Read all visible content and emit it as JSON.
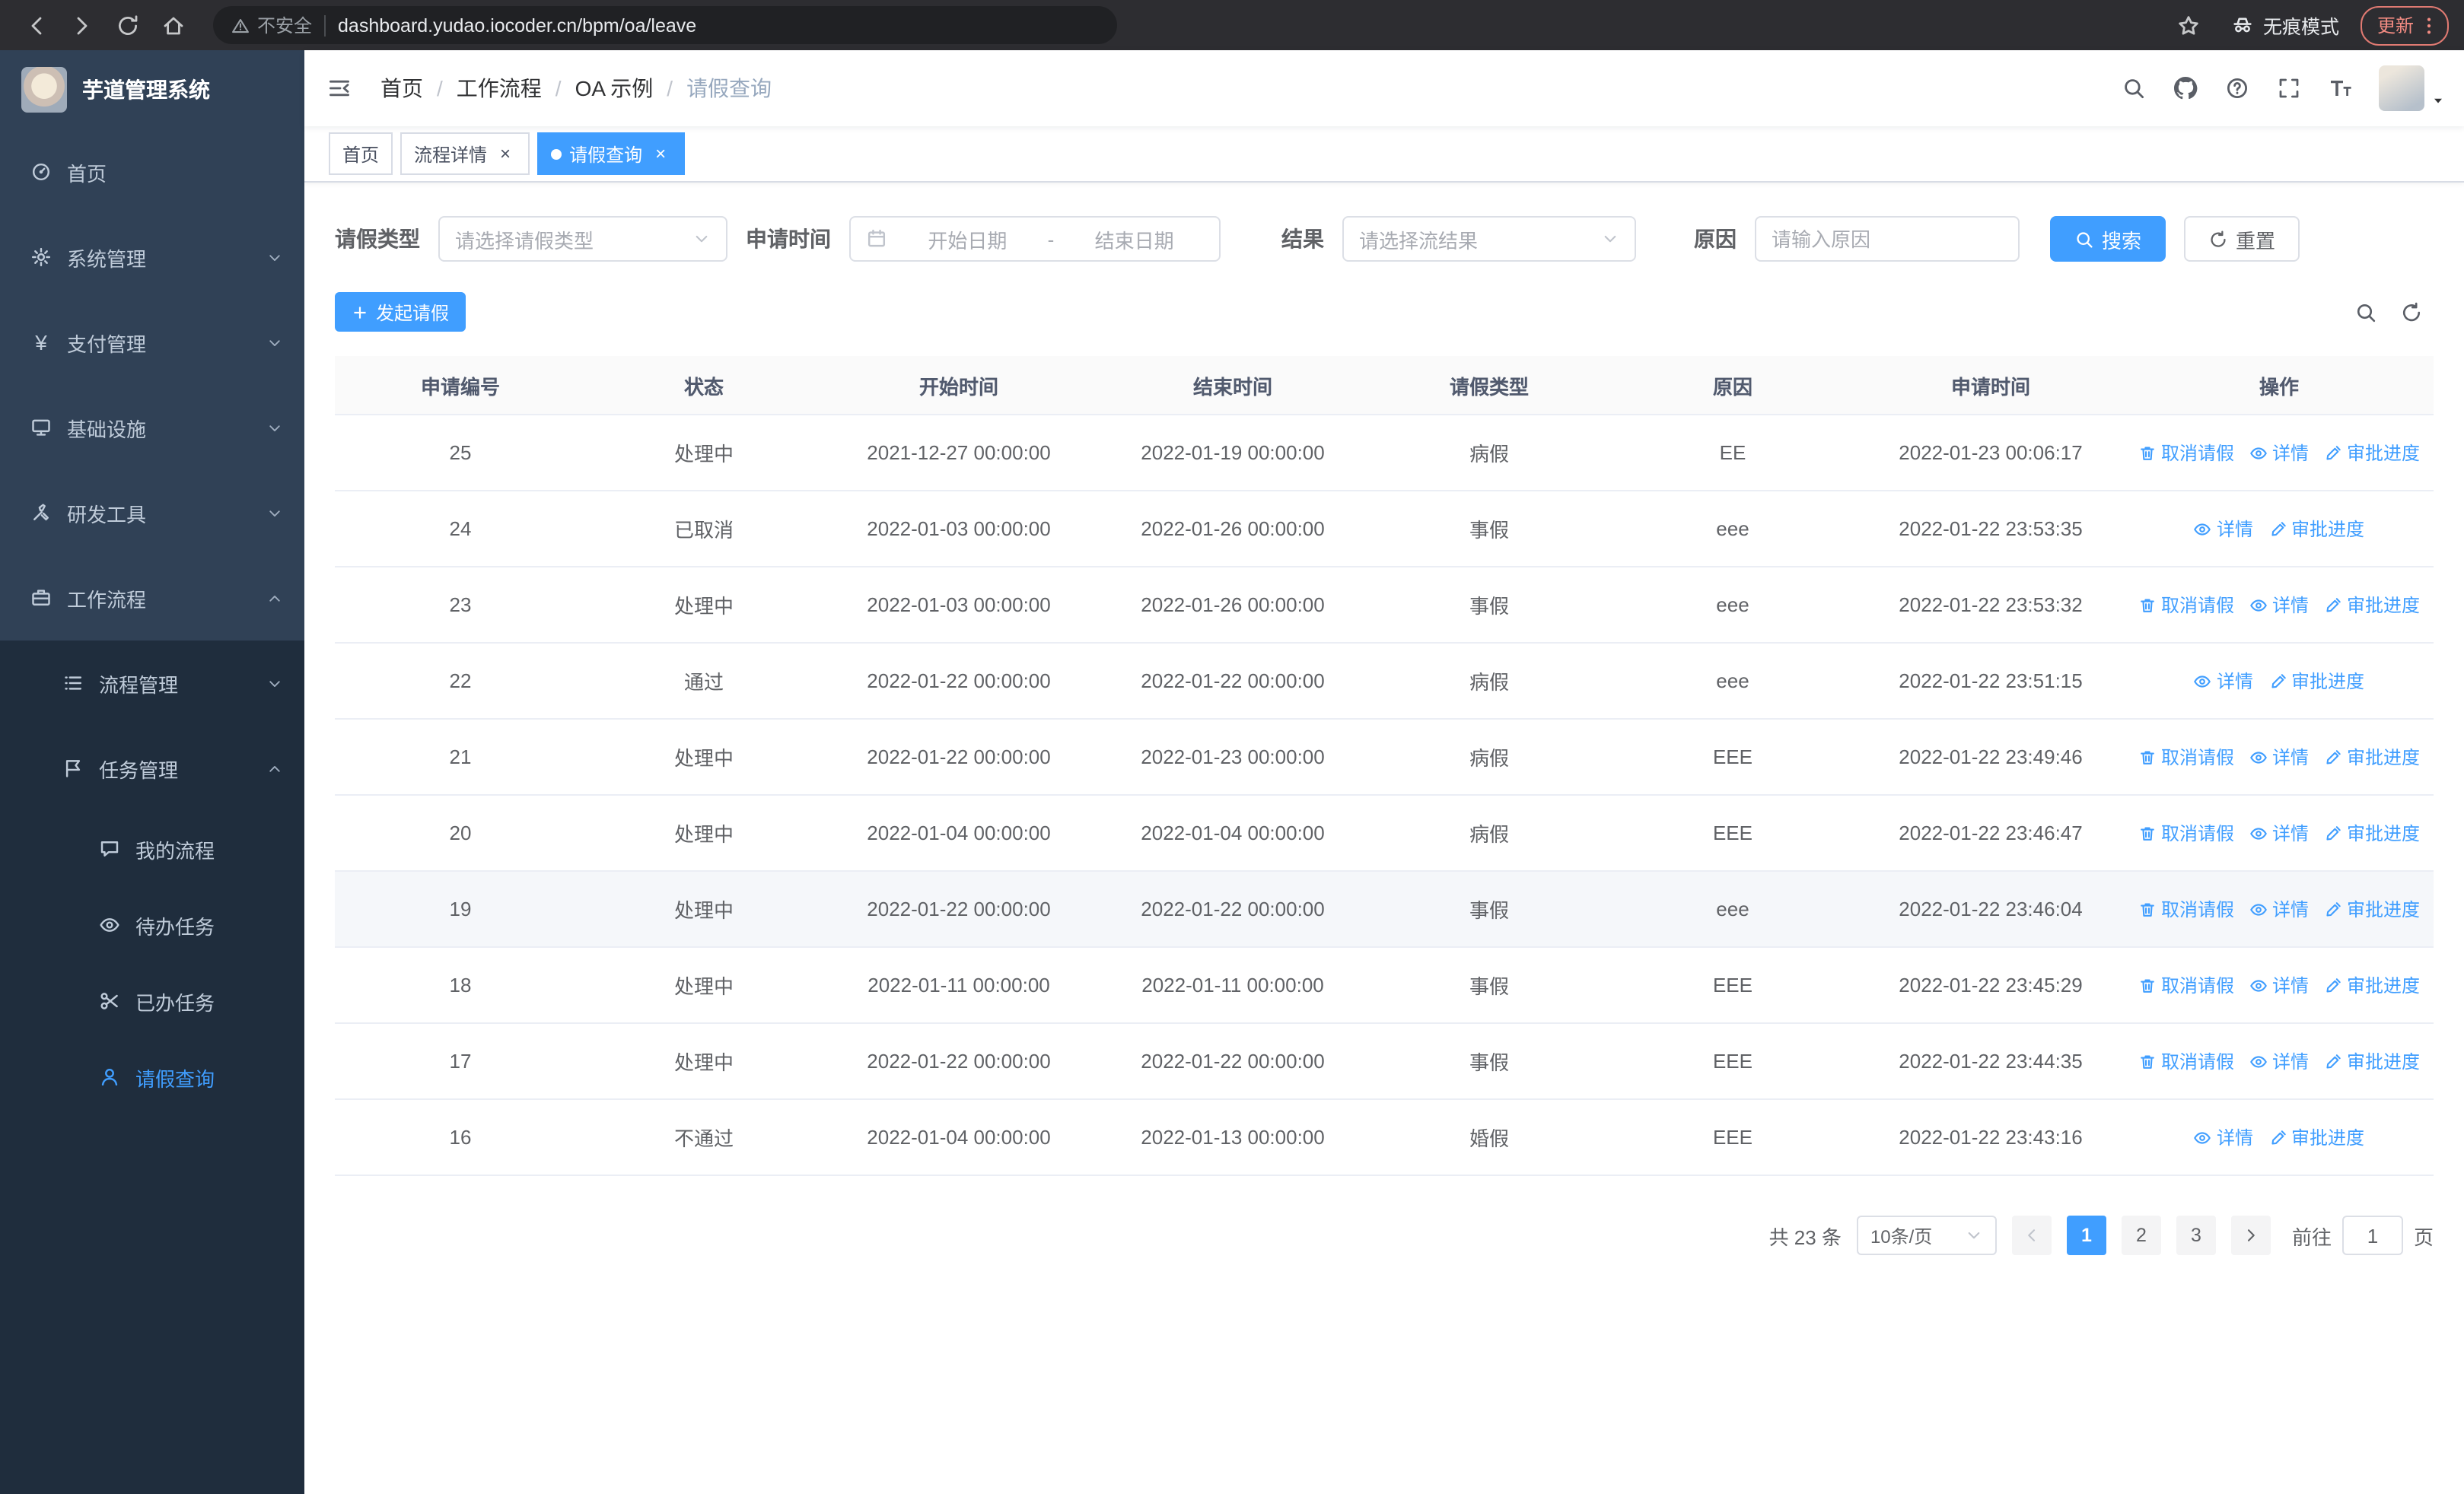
{
  "theme": {
    "accent": "#409EFF",
    "sidebar_bg": "#304156",
    "sidebar_sub_bg": "#1F2D3D"
  },
  "browser": {
    "security_label": "不安全",
    "url": "dashboard.yudao.iocoder.cn/bpm/oa/leave",
    "incognito_label": "无痕模式",
    "update_label": "更新"
  },
  "sidebar": {
    "logo_title": "芋道管理系统",
    "menu": [
      {
        "key": "home",
        "label": "首页",
        "icon": "dashboard",
        "level": 1
      },
      {
        "key": "system",
        "label": "系统管理",
        "icon": "gear",
        "level": 1,
        "chevron": "down"
      },
      {
        "key": "payment",
        "label": "支付管理",
        "icon": "yen",
        "level": 1,
        "chevron": "down"
      },
      {
        "key": "infrastructure",
        "label": "基础设施",
        "icon": "infra",
        "level": 1,
        "chevron": "down"
      },
      {
        "key": "devtools",
        "label": "研发工具",
        "icon": "tools",
        "level": 1,
        "chevron": "down"
      },
      {
        "key": "workflow",
        "label": "工作流程",
        "icon": "workflow",
        "level": 1,
        "chevron": "up"
      },
      {
        "key": "process-management",
        "label": "流程管理",
        "icon": "process",
        "level": 2,
        "chevron": "down"
      },
      {
        "key": "task-management",
        "label": "任务管理",
        "icon": "task",
        "level": 2,
        "chevron": "up"
      },
      {
        "key": "my-process",
        "label": "我的流程",
        "icon": "chat",
        "level": 3
      },
      {
        "key": "todo-tasks",
        "label": "待办任务",
        "icon": "eye",
        "level": 3
      },
      {
        "key": "done-tasks",
        "label": "已办任务",
        "icon": "scissors",
        "level": 3
      },
      {
        "key": "leave-query",
        "label": "请假查询",
        "icon": "user",
        "level": 3,
        "active": true
      }
    ]
  },
  "header": {
    "breadcrumb": [
      "首页",
      "工作流程",
      "OA 示例",
      "请假查询"
    ]
  },
  "tabs": [
    {
      "key": "home",
      "label": "首页",
      "closable": false,
      "active": false
    },
    {
      "key": "process-detail",
      "label": "流程详情",
      "closable": true,
      "active": false
    },
    {
      "key": "leave-query",
      "label": "请假查询",
      "closable": true,
      "active": true
    }
  ],
  "filters": {
    "leave_type_label": "请假类型",
    "leave_type_placeholder": "请选择请假类型",
    "apply_time_label": "申请时间",
    "start_date_placeholder": "开始日期",
    "range_separator": "-",
    "end_date_placeholder": "结束日期",
    "result_label": "结果",
    "result_placeholder": "请选择流结果",
    "reason_label": "原因",
    "reason_placeholder": "请输入原因",
    "search_label": "搜索",
    "reset_label": "重置"
  },
  "toolbar": {
    "create_label": "发起请假"
  },
  "table": {
    "columns": [
      "申请编号",
      "状态",
      "开始时间",
      "结束时间",
      "请假类型",
      "原因",
      "申请时间",
      "操作"
    ],
    "action_defs": {
      "cancel": {
        "label": "取消请假",
        "icon": "trash"
      },
      "detail": {
        "label": "详情",
        "icon": "eye"
      },
      "progress": {
        "label": "审批进度",
        "icon": "edit"
      }
    },
    "rows": [
      {
        "id": "25",
        "status": "处理中",
        "start": "2021-12-27 00:00:00",
        "end": "2022-01-19 00:00:00",
        "type": "病假",
        "reason": "EE",
        "applied": "2022-01-23 00:06:17",
        "actions": [
          "cancel",
          "detail",
          "progress"
        ]
      },
      {
        "id": "24",
        "status": "已取消",
        "start": "2022-01-03 00:00:00",
        "end": "2022-01-26 00:00:00",
        "type": "事假",
        "reason": "eee",
        "applied": "2022-01-22 23:53:35",
        "actions": [
          "detail",
          "progress"
        ]
      },
      {
        "id": "23",
        "status": "处理中",
        "start": "2022-01-03 00:00:00",
        "end": "2022-01-26 00:00:00",
        "type": "事假",
        "reason": "eee",
        "applied": "2022-01-22 23:53:32",
        "actions": [
          "cancel",
          "detail",
          "progress"
        ]
      },
      {
        "id": "22",
        "status": "通过",
        "start": "2022-01-22 00:00:00",
        "end": "2022-01-22 00:00:00",
        "type": "病假",
        "reason": "eee",
        "applied": "2022-01-22 23:51:15",
        "actions": [
          "detail",
          "progress"
        ]
      },
      {
        "id": "21",
        "status": "处理中",
        "start": "2022-01-22 00:00:00",
        "end": "2022-01-23 00:00:00",
        "type": "病假",
        "reason": "EEE",
        "applied": "2022-01-22 23:49:46",
        "actions": [
          "cancel",
          "detail",
          "progress"
        ]
      },
      {
        "id": "20",
        "status": "处理中",
        "start": "2022-01-04 00:00:00",
        "end": "2022-01-04 00:00:00",
        "type": "病假",
        "reason": "EEE",
        "applied": "2022-01-22 23:46:47",
        "actions": [
          "cancel",
          "detail",
          "progress"
        ]
      },
      {
        "id": "19",
        "status": "处理中",
        "start": "2022-01-22 00:00:00",
        "end": "2022-01-22 00:00:00",
        "type": "事假",
        "reason": "eee",
        "applied": "2022-01-22 23:46:04",
        "actions": [
          "cancel",
          "detail",
          "progress"
        ],
        "highlighted": true
      },
      {
        "id": "18",
        "status": "处理中",
        "start": "2022-01-11 00:00:00",
        "end": "2022-01-11 00:00:00",
        "type": "事假",
        "reason": "EEE",
        "applied": "2022-01-22 23:45:29",
        "actions": [
          "cancel",
          "detail",
          "progress"
        ]
      },
      {
        "id": "17",
        "status": "处理中",
        "start": "2022-01-22 00:00:00",
        "end": "2022-01-22 00:00:00",
        "type": "事假",
        "reason": "EEE",
        "applied": "2022-01-22 23:44:35",
        "actions": [
          "cancel",
          "detail",
          "progress"
        ]
      },
      {
        "id": "16",
        "status": "不通过",
        "start": "2022-01-04 00:00:00",
        "end": "2022-01-13 00:00:00",
        "type": "婚假",
        "reason": "EEE",
        "applied": "2022-01-22 23:43:16",
        "actions": [
          "detail",
          "progress"
        ]
      }
    ]
  },
  "pagination": {
    "total_text": "共 23 条",
    "page_size": "10条/页",
    "pages": [
      "1",
      "2",
      "3"
    ],
    "active_page": "1",
    "goto_label": "前往",
    "goto_value": "1",
    "goto_suffix": "页"
  }
}
